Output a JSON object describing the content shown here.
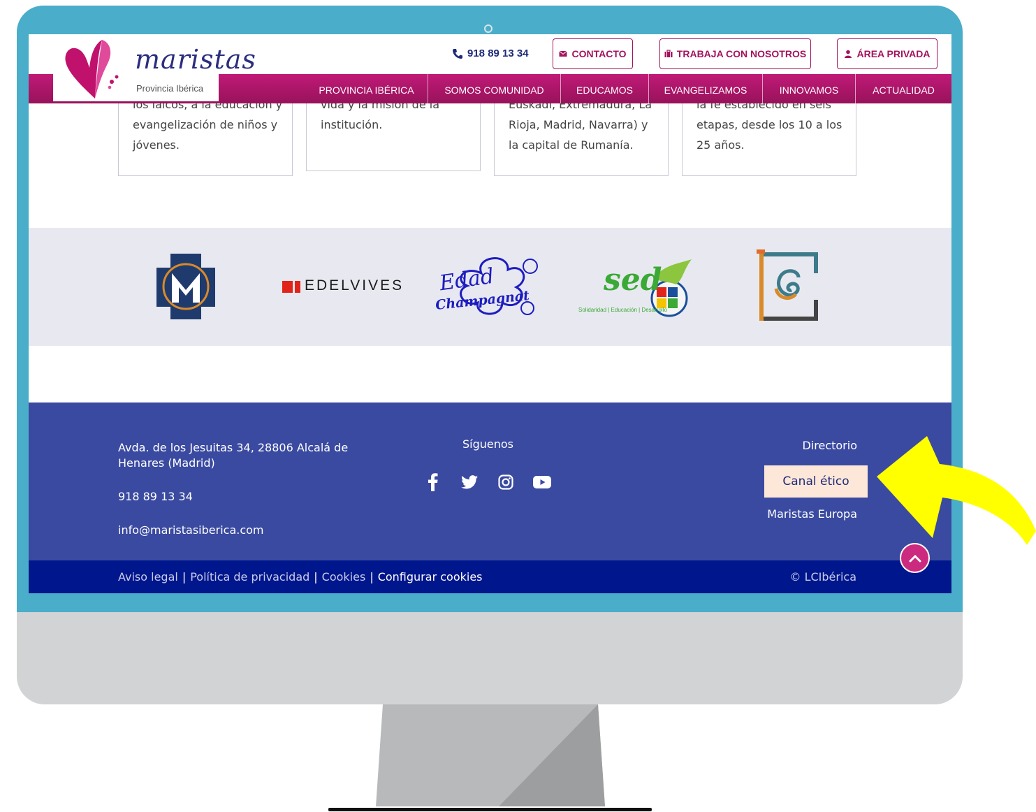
{
  "header": {
    "phone": "918 89 13 34",
    "contacto_label": "CONTACTO",
    "trabaja_label": "TRABAJA CON NOSOTROS",
    "area_label": "ÁREA PRIVADA"
  },
  "logo": {
    "wordmark": "maristas",
    "subtitle": "Provincia Ibérica"
  },
  "nav": {
    "items": [
      "PROVINCIA IBÉRICA",
      "SOMOS COMUNIDAD",
      "EDUCAMOS",
      "EVANGELIZAMOS",
      "INNOVAMOS",
      "ACTUALIDAD"
    ]
  },
  "cards": [
    {
      "lines": [
        "los laicos, a la educación y",
        "evangelización de niños y",
        "jóvenes."
      ]
    },
    {
      "lines": [
        "vida y la misión de la",
        "institución."
      ]
    },
    {
      "lines": [
        "Euskadi, Extremadura, La",
        "Rioja,  Madrid, Navarra) y",
        "la capital de Rumanía."
      ]
    },
    {
      "lines": [
        "la fe establecido en seis",
        "etapas, desde los 10 a los",
        "25 años."
      ]
    }
  ],
  "partners": {
    "edelvives": "EDELVIVES",
    "edebe_line1": "Edad",
    "edebe_line2": "Champagnat",
    "sed_word": "sed",
    "sed_tagline": "Solidaridad | Educación | Desarrollo"
  },
  "footer": {
    "address": "Avda. de los Jesuitas 34, 28806 Alcalá de Henares (Madrid)",
    "phone": "918 89 13 34",
    "email": "info@maristasiberica.com",
    "follow": "Síguenos",
    "directorio": "Directorio",
    "canal": "Canal ético",
    "europa": "Maristas Europa"
  },
  "social_icons": [
    "facebook-icon",
    "twitter-icon",
    "instagram-icon",
    "youtube-icon"
  ],
  "legal": {
    "aviso": "Aviso legal",
    "privacidad": "Política de privacidad",
    "cookies": "Cookies",
    "configurar": "Configurar cookies",
    "copyright": "© LCIbérica"
  },
  "colors": {
    "brand_magenta": "#a3135e",
    "footer_blue": "#3a4aa0",
    "bottom_bar": "#00168c",
    "highlight": "#fde7d8",
    "arrow": "#ffff00"
  }
}
